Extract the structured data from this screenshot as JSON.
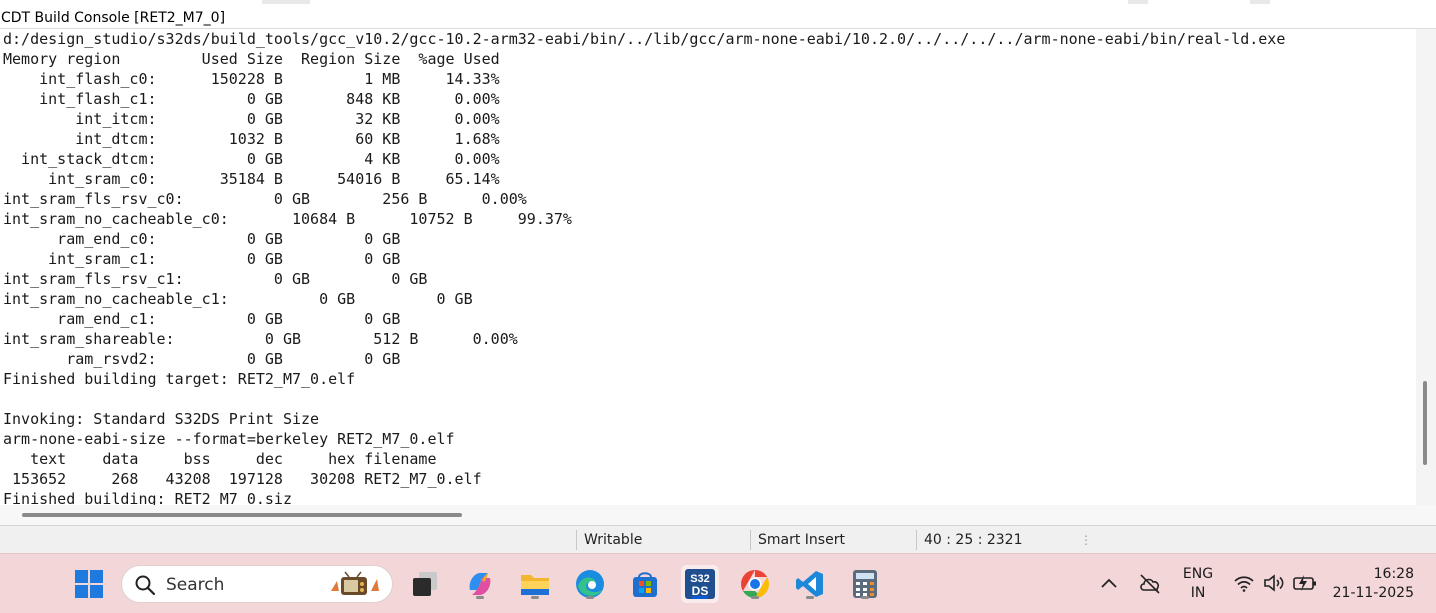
{
  "window": {
    "tab_title": "CDT Build Console [RET2_M7_0]"
  },
  "console": {
    "lines": [
      "d:/design_studio/s32ds/build_tools/gcc_v10.2/gcc-10.2-arm32-eabi/bin/../lib/gcc/arm-none-eabi/10.2.0/../../../../arm-none-eabi/bin/real-ld.exe",
      "Memory region         Used Size  Region Size  %age Used",
      "    int_flash_c0:      150228 B         1 MB     14.33%",
      "    int_flash_c1:          0 GB       848 KB      0.00%",
      "        int_itcm:          0 GB        32 KB      0.00%",
      "        int_dtcm:        1032 B        60 KB      1.68%",
      "  int_stack_dtcm:          0 GB         4 KB      0.00%",
      "     int_sram_c0:       35184 B      54016 B     65.14%",
      "int_sram_fls_rsv_c0:          0 GB        256 B      0.00%",
      "int_sram_no_cacheable_c0:       10684 B      10752 B     99.37%",
      "      ram_end_c0:          0 GB         0 GB",
      "     int_sram_c1:          0 GB         0 GB",
      "int_sram_fls_rsv_c1:          0 GB         0 GB",
      "int_sram_no_cacheable_c1:          0 GB         0 GB",
      "      ram_end_c1:          0 GB         0 GB",
      "int_sram_shareable:          0 GB        512 B      0.00%",
      "       ram_rsvd2:          0 GB         0 GB",
      "Finished building target: RET2_M7_0.elf",
      "",
      "Invoking: Standard S32DS Print Size",
      "arm-none-eabi-size --format=berkeley RET2_M7_0.elf",
      "   text    data     bss     dec     hex filename",
      " 153652     268   43208  197128   30208 RET2_M7_0.elf",
      "Finished building: RET2_M7_0.siz"
    ]
  },
  "status_bar": {
    "mode": "Writable",
    "insert_mode": "Smart Insert",
    "position": "40 : 25 : 2321"
  },
  "taskbar": {
    "search_placeholder": "Search",
    "icons": [
      {
        "name": "start-icon"
      },
      {
        "name": "widgets-icon"
      },
      {
        "name": "task-view-icon"
      },
      {
        "name": "copilot-icon"
      },
      {
        "name": "file-explorer-icon"
      },
      {
        "name": "edge-icon"
      },
      {
        "name": "store-icon"
      },
      {
        "name": "s32ds-icon",
        "label": "S32 DS"
      },
      {
        "name": "chrome-icon"
      },
      {
        "name": "vscode-icon"
      },
      {
        "name": "calculator-icon"
      }
    ],
    "tray": {
      "language_top": "ENG",
      "language_bottom": "IN",
      "time": "16:28",
      "date": "21-11-2025"
    }
  },
  "colors": {
    "taskbar_bg": "#f3d6d8",
    "active_indicator": "#0a5bd6",
    "console_text": "#1a1a1a"
  }
}
